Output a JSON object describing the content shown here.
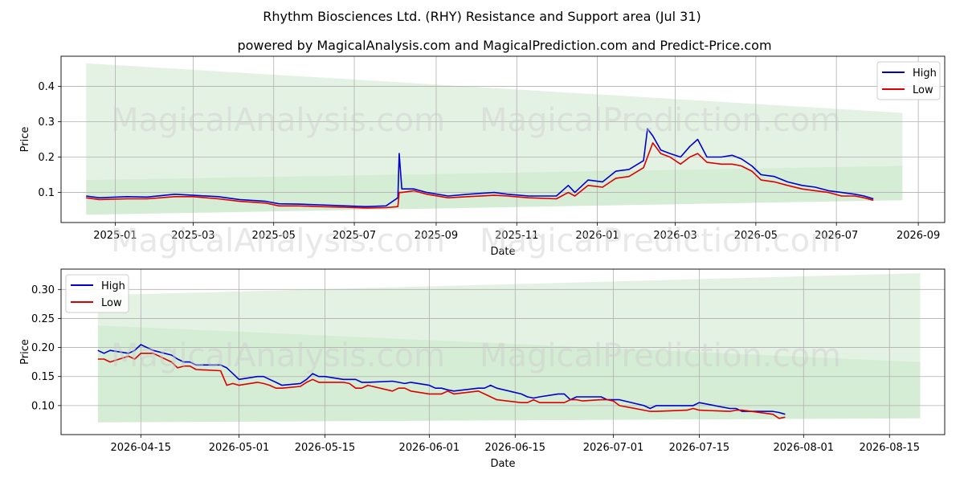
{
  "title": "Rhythm Biosciences Ltd. (RHY) Resistance and Support area (Jul 31)",
  "subtitle": "powered by MagicalAnalysis.com and MagicalPrediction.com and Predict-Price.com",
  "watermark_left": "MagicalAnalysis.com",
  "watermark_right": "MagicalPrediction.com",
  "colors": {
    "high": "#0000cc",
    "low": "#dd0000",
    "band": "#2e9e2e",
    "grid": "#b0b0b0"
  },
  "chart_data": [
    {
      "type": "line",
      "xlabel": "Date",
      "ylabel": "Price",
      "xlim": [
        "2024-11-21",
        "2026-09-21"
      ],
      "ylim": [
        0.015,
        0.485
      ],
      "xticks": [
        "2025-01",
        "2025-03",
        "2025-05",
        "2025-07",
        "2025-09",
        "2025-11",
        "2026-01",
        "2026-03",
        "2026-05",
        "2026-07",
        "2026-09"
      ],
      "xtick_dates": [
        "2025-01-01",
        "2025-03-01",
        "2025-05-01",
        "2025-07-01",
        "2025-09-01",
        "2025-11-01",
        "2026-01-01",
        "2026-03-01",
        "2026-05-01",
        "2026-07-01",
        "2026-09-01"
      ],
      "yticks": [
        0.1,
        0.2,
        0.3,
        0.4
      ],
      "ytick_labels": [
        "0.1",
        "0.2",
        "0.3",
        "0.4"
      ],
      "grid": true,
      "legend": "top-right",
      "bands": [
        {
          "x": [
            "2024-12-10",
            "2026-08-20"
          ],
          "upper": [
            0.465,
            0.325
          ],
          "lower": [
            0.135,
            0.175
          ]
        },
        {
          "x": [
            "2024-12-10",
            "2026-08-20"
          ],
          "upper": [
            0.135,
            0.175
          ],
          "lower": [
            0.037,
            0.078
          ]
        }
      ],
      "series": [
        {
          "name": "High",
          "x": [
            "2024-12-10",
            "2024-12-20",
            "2025-01-10",
            "2025-01-25",
            "2025-02-15",
            "2025-03-01",
            "2025-03-20",
            "2025-04-05",
            "2025-04-25",
            "2025-05-05",
            "2025-05-20",
            "2025-06-05",
            "2025-06-25",
            "2025-07-10",
            "2025-07-25",
            "2025-08-03",
            "2025-08-04",
            "2025-08-06",
            "2025-08-15",
            "2025-08-25",
            "2025-09-10",
            "2025-09-25",
            "2025-10-15",
            "2025-10-25",
            "2025-11-10",
            "2025-12-01",
            "2025-12-10",
            "2025-12-15",
            "2025-12-25",
            "2026-01-05",
            "2026-01-15",
            "2026-01-25",
            "2026-02-05",
            "2026-02-08",
            "2026-02-12",
            "2026-02-18",
            "2026-02-25",
            "2026-03-05",
            "2026-03-12",
            "2026-03-18",
            "2026-03-25",
            "2026-04-05",
            "2026-04-13",
            "2026-04-20",
            "2026-04-28",
            "2026-05-05",
            "2026-05-15",
            "2026-05-25",
            "2026-06-05",
            "2026-06-15",
            "2026-06-25",
            "2026-07-05",
            "2026-07-15",
            "2026-07-22",
            "2026-07-29"
          ],
          "values": [
            0.09,
            0.085,
            0.088,
            0.087,
            0.095,
            0.092,
            0.088,
            0.08,
            0.075,
            0.068,
            0.067,
            0.065,
            0.062,
            0.06,
            0.062,
            0.085,
            0.21,
            0.11,
            0.11,
            0.1,
            0.09,
            0.095,
            0.1,
            0.095,
            0.09,
            0.09,
            0.12,
            0.1,
            0.135,
            0.13,
            0.16,
            0.165,
            0.19,
            0.28,
            0.26,
            0.22,
            0.21,
            0.2,
            0.23,
            0.25,
            0.2,
            0.2,
            0.205,
            0.195,
            0.175,
            0.15,
            0.145,
            0.13,
            0.12,
            0.115,
            0.105,
            0.1,
            0.095,
            0.09,
            0.082
          ]
        },
        {
          "name": "Low",
          "x": [
            "2024-12-10",
            "2024-12-20",
            "2025-01-10",
            "2025-01-25",
            "2025-02-15",
            "2025-03-01",
            "2025-03-20",
            "2025-04-05",
            "2025-04-25",
            "2025-05-05",
            "2025-05-20",
            "2025-06-05",
            "2025-06-25",
            "2025-07-10",
            "2025-07-25",
            "2025-08-03",
            "2025-08-04",
            "2025-08-06",
            "2025-08-15",
            "2025-08-25",
            "2025-09-10",
            "2025-09-25",
            "2025-10-15",
            "2025-10-25",
            "2025-11-10",
            "2025-12-01",
            "2025-12-10",
            "2025-12-15",
            "2025-12-25",
            "2026-01-05",
            "2026-01-15",
            "2026-01-25",
            "2026-02-05",
            "2026-02-08",
            "2026-02-12",
            "2026-02-18",
            "2026-02-25",
            "2026-03-05",
            "2026-03-12",
            "2026-03-18",
            "2026-03-25",
            "2026-04-05",
            "2026-04-13",
            "2026-04-20",
            "2026-04-28",
            "2026-05-05",
            "2026-05-15",
            "2026-05-25",
            "2026-06-05",
            "2026-06-15",
            "2026-06-25",
            "2026-07-05",
            "2026-07-15",
            "2026-07-22",
            "2026-07-29"
          ],
          "values": [
            0.085,
            0.08,
            0.082,
            0.082,
            0.088,
            0.088,
            0.082,
            0.075,
            0.07,
            0.062,
            0.062,
            0.06,
            0.058,
            0.056,
            0.057,
            0.06,
            0.1,
            0.1,
            0.105,
            0.095,
            0.085,
            0.088,
            0.092,
            0.09,
            0.085,
            0.082,
            0.1,
            0.09,
            0.12,
            0.115,
            0.14,
            0.145,
            0.17,
            0.2,
            0.24,
            0.21,
            0.2,
            0.18,
            0.2,
            0.21,
            0.185,
            0.18,
            0.18,
            0.175,
            0.16,
            0.135,
            0.13,
            0.12,
            0.11,
            0.105,
            0.1,
            0.09,
            0.09,
            0.085,
            0.078
          ]
        }
      ]
    },
    {
      "type": "line",
      "xlabel": "Date",
      "ylabel": "Price",
      "xlim": [
        "2026-04-02",
        "2026-08-24"
      ],
      "ylim": [
        0.05,
        0.335
      ],
      "xticks": [
        "2026-04-15",
        "2026-05-01",
        "2026-05-15",
        "2026-06-01",
        "2026-06-15",
        "2026-07-01",
        "2026-07-15",
        "2026-08-01",
        "2026-08-15"
      ],
      "xtick_dates": [
        "2026-04-15",
        "2026-05-01",
        "2026-05-15",
        "2026-06-01",
        "2026-06-15",
        "2026-07-01",
        "2026-07-15",
        "2026-08-01",
        "2026-08-15"
      ],
      "yticks": [
        0.1,
        0.15,
        0.2,
        0.25,
        0.3
      ],
      "ytick_labels": [
        "0.10",
        "0.15",
        "0.20",
        "0.25",
        "0.30"
      ],
      "grid": true,
      "legend": "top-left",
      "bands": [
        {
          "x": [
            "2026-04-08",
            "2026-08-20"
          ],
          "upper": [
            0.29,
            0.328
          ],
          "lower": [
            0.238,
            0.175
          ]
        },
        {
          "x": [
            "2026-04-08",
            "2026-08-20"
          ],
          "upper": [
            0.238,
            0.175
          ],
          "lower": [
            0.071,
            0.078
          ]
        }
      ],
      "series": [
        {
          "name": "High",
          "x": [
            "2026-04-08",
            "2026-04-09",
            "2026-04-10",
            "2026-04-13",
            "2026-04-14",
            "2026-04-15",
            "2026-04-17",
            "2026-04-20",
            "2026-04-21",
            "2026-04-22",
            "2026-04-23",
            "2026-04-24",
            "2026-04-28",
            "2026-04-29",
            "2026-04-30",
            "2026-05-01",
            "2026-05-04",
            "2026-05-05",
            "2026-05-06",
            "2026-05-07",
            "2026-05-08",
            "2026-05-11",
            "2026-05-12",
            "2026-05-13",
            "2026-05-14",
            "2026-05-15",
            "2026-05-18",
            "2026-05-19",
            "2026-05-20",
            "2026-05-21",
            "2026-05-22",
            "2026-05-26",
            "2026-05-27",
            "2026-05-28",
            "2026-05-29",
            "2026-06-01",
            "2026-06-02",
            "2026-06-03",
            "2026-06-04",
            "2026-06-05",
            "2026-06-09",
            "2026-06-10",
            "2026-06-11",
            "2026-06-12",
            "2026-06-16",
            "2026-06-17",
            "2026-06-18",
            "2026-06-19",
            "2026-06-22",
            "2026-06-23",
            "2026-06-24",
            "2026-06-25",
            "2026-06-26",
            "2026-06-29",
            "2026-06-30",
            "2026-07-01",
            "2026-07-02",
            "2026-07-06",
            "2026-07-07",
            "2026-07-08",
            "2026-07-13",
            "2026-07-14",
            "2026-07-15",
            "2026-07-20",
            "2026-07-21",
            "2026-07-22",
            "2026-07-27",
            "2026-07-28",
            "2026-07-29"
          ],
          "values": [
            0.195,
            0.19,
            0.195,
            0.19,
            0.195,
            0.205,
            0.195,
            0.187,
            0.18,
            0.175,
            0.175,
            0.17,
            0.17,
            0.165,
            0.155,
            0.145,
            0.15,
            0.15,
            0.145,
            0.14,
            0.135,
            0.138,
            0.145,
            0.155,
            0.15,
            0.15,
            0.145,
            0.145,
            0.145,
            0.14,
            0.14,
            0.142,
            0.14,
            0.138,
            0.14,
            0.135,
            0.13,
            0.13,
            0.127,
            0.125,
            0.13,
            0.13,
            0.135,
            0.13,
            0.12,
            0.115,
            0.113,
            0.115,
            0.12,
            0.12,
            0.11,
            0.115,
            0.115,
            0.115,
            0.11,
            0.11,
            0.11,
            0.1,
            0.095,
            0.1,
            0.1,
            0.1,
            0.105,
            0.095,
            0.095,
            0.09,
            0.09,
            0.088,
            0.085
          ]
        },
        {
          "name": "Low",
          "x": [
            "2026-04-08",
            "2026-04-09",
            "2026-04-10",
            "2026-04-13",
            "2026-04-14",
            "2026-04-15",
            "2026-04-17",
            "2026-04-20",
            "2026-04-21",
            "2026-04-22",
            "2026-04-23",
            "2026-04-24",
            "2026-04-28",
            "2026-04-29",
            "2026-04-30",
            "2026-05-01",
            "2026-05-04",
            "2026-05-05",
            "2026-05-06",
            "2026-05-07",
            "2026-05-08",
            "2026-05-11",
            "2026-05-12",
            "2026-05-13",
            "2026-05-14",
            "2026-05-15",
            "2026-05-18",
            "2026-05-19",
            "2026-05-20",
            "2026-05-21",
            "2026-05-22",
            "2026-05-26",
            "2026-05-27",
            "2026-05-28",
            "2026-05-29",
            "2026-06-01",
            "2026-06-02",
            "2026-06-03",
            "2026-06-04",
            "2026-06-05",
            "2026-06-09",
            "2026-06-10",
            "2026-06-11",
            "2026-06-12",
            "2026-06-16",
            "2026-06-17",
            "2026-06-18",
            "2026-06-19",
            "2026-06-22",
            "2026-06-23",
            "2026-06-24",
            "2026-06-25",
            "2026-06-26",
            "2026-06-29",
            "2026-06-30",
            "2026-07-01",
            "2026-07-02",
            "2026-07-06",
            "2026-07-07",
            "2026-07-08",
            "2026-07-13",
            "2026-07-14",
            "2026-07-15",
            "2026-07-20",
            "2026-07-21",
            "2026-07-22",
            "2026-07-27",
            "2026-07-28",
            "2026-07-29"
          ],
          "values": [
            0.18,
            0.18,
            0.175,
            0.185,
            0.18,
            0.19,
            0.19,
            0.175,
            0.165,
            0.168,
            0.168,
            0.162,
            0.16,
            0.135,
            0.138,
            0.135,
            0.14,
            0.138,
            0.135,
            0.13,
            0.13,
            0.133,
            0.14,
            0.145,
            0.14,
            0.14,
            0.14,
            0.138,
            0.13,
            0.13,
            0.135,
            0.125,
            0.13,
            0.13,
            0.125,
            0.12,
            0.12,
            0.12,
            0.125,
            0.12,
            0.125,
            0.12,
            0.115,
            0.11,
            0.105,
            0.105,
            0.11,
            0.105,
            0.105,
            0.105,
            0.11,
            0.11,
            0.108,
            0.11,
            0.11,
            0.108,
            0.1,
            0.092,
            0.09,
            0.09,
            0.092,
            0.095,
            0.092,
            0.09,
            0.092,
            0.092,
            0.085,
            0.078,
            0.08
          ]
        }
      ]
    }
  ]
}
